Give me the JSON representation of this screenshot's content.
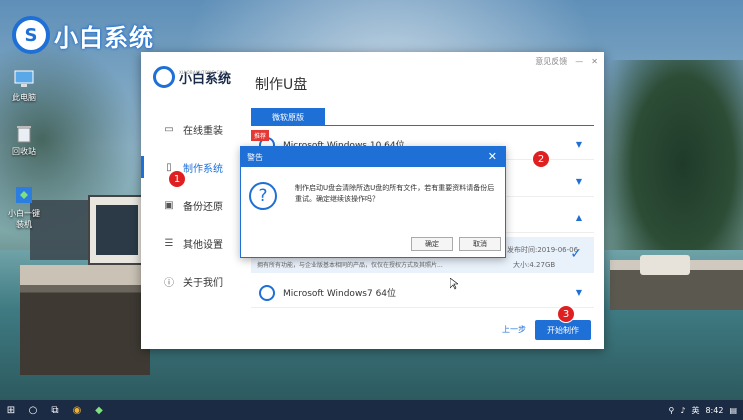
{
  "desktop": {
    "brand_name": "小白系统",
    "icons": [
      {
        "label": "此电脑",
        "icon": "computer-icon"
      },
      {
        "label": "回收站",
        "icon": "recycle-bin-icon"
      },
      {
        "label": "小白一键\n装机",
        "icon": "xiaobai-app-icon"
      }
    ]
  },
  "window": {
    "controls": {
      "feedback": "意见反馈",
      "minimize": "—",
      "close": "✕"
    },
    "logo_name": "小白系统",
    "logo_sub": "XIAOBAIXITONG.COM",
    "title": "制作U盘",
    "nav": [
      {
        "label": "在线重装",
        "icon": "monitor-icon"
      },
      {
        "label": "制作系统",
        "icon": "usb-icon"
      },
      {
        "label": "备份还原",
        "icon": "backup-icon"
      },
      {
        "label": "其他设置",
        "icon": "settings-icon"
      },
      {
        "label": "关于我们",
        "icon": "info-icon"
      }
    ],
    "tab": "微软原版",
    "list": [
      {
        "name": "Microsoft Windows 10 64位",
        "badge": "推荐"
      },
      {
        "name": "",
        "badge": ""
      },
      {
        "name": "",
        "badge": ""
      },
      {
        "name": "Microsoft Windows7 64位",
        "badge": ""
      }
    ],
    "detail": {
      "desc": "拥有所有功能，与企业版基本相同的产品，仅仅在授权方式及其照片...",
      "date": "发布时间:2019-06-06",
      "size": "大小:4.27GB"
    },
    "prev_label": "上一步",
    "start_label": "开始制作"
  },
  "dialog": {
    "title": "警告",
    "close": "✕",
    "message": "制作启动U盘会清除所选U盘的所有文件，若有重要资料请备份后重试。确定继续该操作吗？",
    "ok": "确定",
    "cancel": "取消"
  },
  "steps": [
    "1",
    "2",
    "3"
  ],
  "taskbar": {
    "time": "8:42",
    "ime": "英"
  },
  "colors": {
    "accent": "#1e6fd6",
    "step_marker": "#e02020",
    "taskbar": "#1b2b44"
  }
}
